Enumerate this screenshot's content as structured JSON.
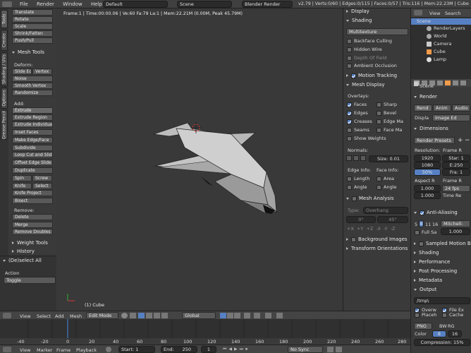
{
  "topbar": {
    "menus": [
      "File",
      "Render",
      "Window",
      "Help"
    ],
    "layout": "Default",
    "scene": "Scene",
    "engine": "Blender Render",
    "stats": "v2.79 | Verts:0/60 | Edges:0/115 | Faces:0/57 | Tris:116 | Mem:22.23M | Cube"
  },
  "vtabs": [
    "Tools",
    "Create",
    "Shading / UVs",
    "Options",
    "Grease Pencil"
  ],
  "toolshelf": {
    "top_buttons": [
      "Translate",
      "Rotate",
      "Scale",
      "Shrink/Fatten",
      "Push/Pull"
    ],
    "mesh_tools": "Mesh Tools",
    "deform_label": "Deform:",
    "deform": [
      [
        "Slide Ed",
        "Vertex"
      ],
      [
        "Noise"
      ],
      [
        "Smooth Vertex"
      ],
      [
        "Randomize"
      ]
    ],
    "add_label": "Add:",
    "add": [
      "Extrude",
      "Extrude Region",
      "Extrude Individual",
      "Inset Faces",
      "Make Edge/Face",
      "Subdivide",
      "Loop Cut and Slide",
      "Offset Edge Slide",
      "Duplicate"
    ],
    "pairs": [
      [
        "Spin",
        "Screw"
      ],
      [
        "Knife",
        "Select"
      ]
    ],
    "after_pairs": [
      "Knife Project",
      "Bisect"
    ],
    "remove_label": "Remove:",
    "remove": [
      "Delete",
      "Merge",
      "Remove Doubles"
    ],
    "weight_tools": "Weight Tools",
    "history": "History"
  },
  "operator": {
    "title": "(De)select All",
    "action_label": "Action",
    "action_value": "Toggle"
  },
  "viewport": {
    "info": "Frame:1 | Time:00:00.06 | Ve:60 Fa:79 La:1 | Mem:22.21M (0.00M, Peak 45.79M)",
    "object_label": "(1) Cube"
  },
  "props": {
    "display": "Display",
    "shading": "Shading",
    "shading_mode": "Multitexture",
    "checks": [
      {
        "label": "Backface Culling",
        "on": false
      },
      {
        "label": "Hidden Wire",
        "on": false
      },
      {
        "label": "Depth Of Field",
        "on": false,
        "dim": true
      },
      {
        "label": "Ambient Occlusion",
        "on": false
      }
    ],
    "motion_tracking": "Motion Tracking",
    "mesh_display": "Mesh Display",
    "overlays_label": "Overlays:",
    "overlays": [
      [
        {
          "label": "Faces",
          "on": true
        },
        {
          "label": "Sharp",
          "on": false
        }
      ],
      [
        {
          "label": "Edges",
          "on": true
        },
        {
          "label": "Bevel",
          "on": false
        }
      ],
      [
        {
          "label": "Creases",
          "on": true
        },
        {
          "label": "Edge Ma",
          "on": false
        }
      ],
      [
        {
          "label": "Seams",
          "on": false
        },
        {
          "label": "Face Ma",
          "on": false
        }
      ]
    ],
    "show_weights": "Show Weights",
    "normals_label": "Normals:",
    "normals_size": "Size: 0.01",
    "edge_info": "Edge Info:",
    "face_info": "Face Info:",
    "info_rows": [
      [
        "Length",
        "Area"
      ],
      [
        "Angle",
        "Angle"
      ]
    ],
    "mesh_analysis": "Mesh Analysis",
    "type_label": "Type:",
    "type_value": "Overhang",
    "angle_min": "0°",
    "angle_max": "45°",
    "axes": [
      "+X",
      "+Y",
      "+Z",
      "-X",
      "-Y",
      "-Z"
    ],
    "background_images": "Background Images",
    "transform_orientations": "Transform Orientations"
  },
  "outliner": {
    "tabs": [
      "View",
      "Search"
    ],
    "items": [
      "Scene",
      "RenderLayers",
      "World",
      "Camera",
      "Cube",
      "Lamp"
    ]
  },
  "render": {
    "scene_label": "Scene",
    "render_hdr": "Render",
    "buttons": [
      "Rend",
      "Anim",
      "Audio"
    ],
    "display_label": "Displa",
    "display_value": "Image Ed",
    "dimensions": "Dimensions",
    "presets": "Render Presets",
    "resolution_label": "Resolution:",
    "frame_label": "Frame R",
    "res": [
      "1920",
      "1080",
      "50%"
    ],
    "frames": [
      "Star: 1",
      "E:250",
      "Fra: 1"
    ],
    "aspect_label": "Aspect R",
    "aspect": [
      "1.000",
      "1.000"
    ],
    "frame_rate_label": "Frame R",
    "fps": "24 fps",
    "time_label": "Time Re",
    "anti_aliasing": "Anti-Aliasing",
    "aa_values": [
      "5",
      "8",
      "11",
      "16"
    ],
    "aa_filter": "Mitchell-",
    "full_sample": "Full Sa",
    "aa_size": "1.000",
    "sampled_motion_blur": "Sampled Motion Bl",
    "collapsed": [
      "Shading",
      "Performance",
      "Post Processing",
      "Metadata",
      "Output"
    ],
    "output_path": "/tmp\\",
    "output_checks": [
      [
        "Overw",
        "File Ex"
      ],
      [
        "Placeh",
        "Cache"
      ]
    ],
    "format": "PNG",
    "color_modes": [
      "BW",
      "RG"
    ],
    "color_label": "Color",
    "color_depth": [
      "8",
      "16"
    ],
    "compression": "Compression: 15%"
  },
  "viewheader": {
    "items": [
      "View",
      "Select",
      "Add",
      "Mesh"
    ],
    "mode": "Edit Mode",
    "orientation": "Global"
  },
  "timeline": {
    "ticks": [
      "-40",
      "-20",
      "0",
      "20",
      "40",
      "60",
      "80",
      "100",
      "120",
      "140",
      "160",
      "180",
      "200",
      "220",
      "240",
      "260",
      "280"
    ]
  },
  "footer": {
    "items": [
      "View",
      "Marker",
      "Frame",
      "Playback"
    ],
    "start": "Start:",
    "start_val": "1",
    "end": "End:",
    "end_val": "250",
    "current": "1",
    "sync": "No Sync"
  },
  "colors": {
    "accent": "#5680c2",
    "panel": "#3a3a3a",
    "viewport": "#393939"
  }
}
